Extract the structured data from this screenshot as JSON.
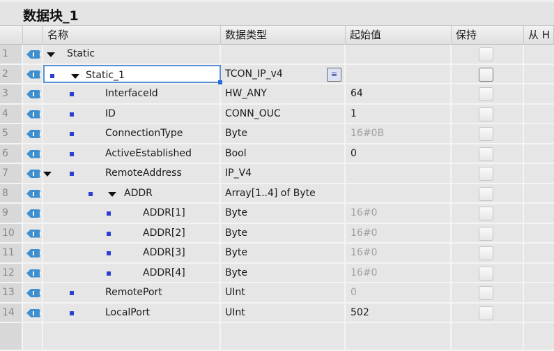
{
  "title": "数据块_1",
  "columns": {
    "name": "名称",
    "type": "数据类型",
    "start": "起始值",
    "retain": "保持",
    "from": "从 H"
  },
  "rows": [
    {
      "num": "1",
      "name": "Static",
      "type": "",
      "start": "",
      "level": 0,
      "expanded": true,
      "bullet": false
    },
    {
      "num": "2",
      "name": "Static_1",
      "type": "TCON_IP_v4",
      "start": "",
      "level": 0,
      "expanded": true,
      "bullet": true,
      "selected": true
    },
    {
      "num": "3",
      "name": "InterfaceId",
      "type": "HW_ANY",
      "start": "64",
      "level": 1,
      "bullet": true
    },
    {
      "num": "4",
      "name": "ID",
      "type": "CONN_OUC",
      "start": "1",
      "level": 1,
      "bullet": true
    },
    {
      "num": "5",
      "name": "ConnectionType",
      "type": "Byte",
      "start": "16#0B",
      "level": 1,
      "bullet": true,
      "start_default": true
    },
    {
      "num": "6",
      "name": "ActiveEstablished",
      "type": "Bool",
      "start": "0",
      "level": 1,
      "bullet": true
    },
    {
      "num": "7",
      "name": "RemoteAddress",
      "type": "IP_V4",
      "start": "",
      "level": 1,
      "expanded": true,
      "bullet": true
    },
    {
      "num": "8",
      "name": "ADDR",
      "type": "Array[1..4] of Byte",
      "start": "",
      "level": 2,
      "expanded": true,
      "bullet": true
    },
    {
      "num": "9",
      "name": "ADDR[1]",
      "type": "Byte",
      "start": "16#0",
      "level": 3,
      "bullet": true,
      "start_default": true
    },
    {
      "num": "10",
      "name": "ADDR[2]",
      "type": "Byte",
      "start": "16#0",
      "level": 3,
      "bullet": true,
      "start_default": true
    },
    {
      "num": "11",
      "name": "ADDR[3]",
      "type": "Byte",
      "start": "16#0",
      "level": 3,
      "bullet": true,
      "start_default": true
    },
    {
      "num": "12",
      "name": "ADDR[4]",
      "type": "Byte",
      "start": "16#0",
      "level": 3,
      "bullet": true,
      "start_default": true
    },
    {
      "num": "13",
      "name": "RemotePort",
      "type": "UInt",
      "start": "0",
      "level": 1,
      "bullet": true,
      "start_default": true
    },
    {
      "num": "14",
      "name": "LocalPort",
      "type": "UInt",
      "start": "502",
      "level": 1,
      "bullet": true
    }
  ],
  "colors": {
    "accent": "#2d3fcf",
    "selection": "#5a8fd6",
    "icon": "#3d8fd0"
  },
  "icons": {
    "row": "interface-tag-icon",
    "type_picker": "list-icon"
  }
}
